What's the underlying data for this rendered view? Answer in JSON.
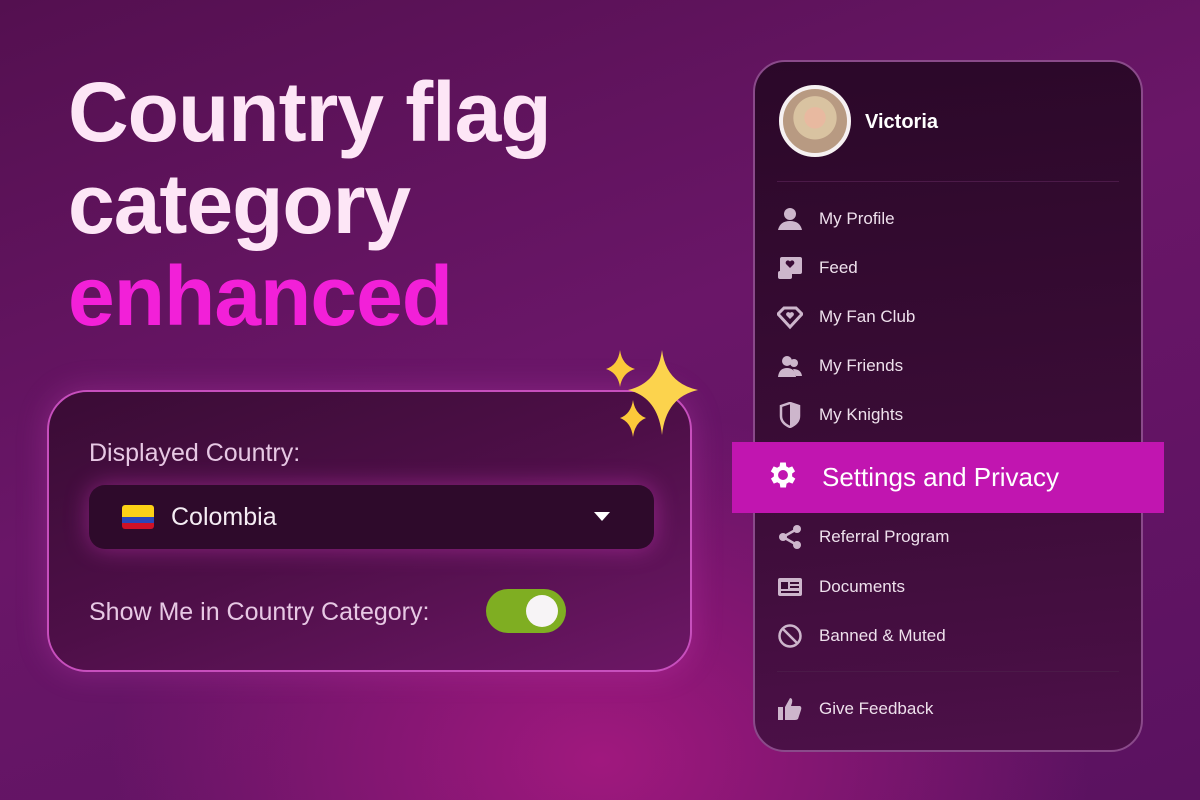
{
  "headline": {
    "line1": "Country flag",
    "line2": "category",
    "line3": "enhanced"
  },
  "colors": {
    "accent": "#f220d8",
    "highlight": "#c115b0",
    "toggle_on": "#7fae22"
  },
  "settings_card": {
    "country_label": "Displayed Country:",
    "country_value": "Colombia",
    "country_flag": "colombia-flag",
    "show_label": "Show Me in Country Category:",
    "show_enabled": true
  },
  "menu": {
    "username": "Victoria",
    "items": [
      {
        "label": "My Profile",
        "icon": "user-icon"
      },
      {
        "label": "Feed",
        "icon": "feed-icon"
      },
      {
        "label": "My Fan Club",
        "icon": "diamond-heart-icon"
      },
      {
        "label": "My Friends",
        "icon": "friends-icon"
      },
      {
        "label": "My Knights",
        "icon": "shield-icon"
      },
      {
        "label": "Settings and Privacy",
        "icon": "gear-icon",
        "active": true
      },
      {
        "label": "Referral Program",
        "icon": "share-icon"
      },
      {
        "label": "Documents",
        "icon": "id-card-icon"
      },
      {
        "label": "Banned & Muted",
        "icon": "ban-icon"
      },
      {
        "label": "Give Feedback",
        "icon": "thumbs-up-icon"
      }
    ]
  }
}
